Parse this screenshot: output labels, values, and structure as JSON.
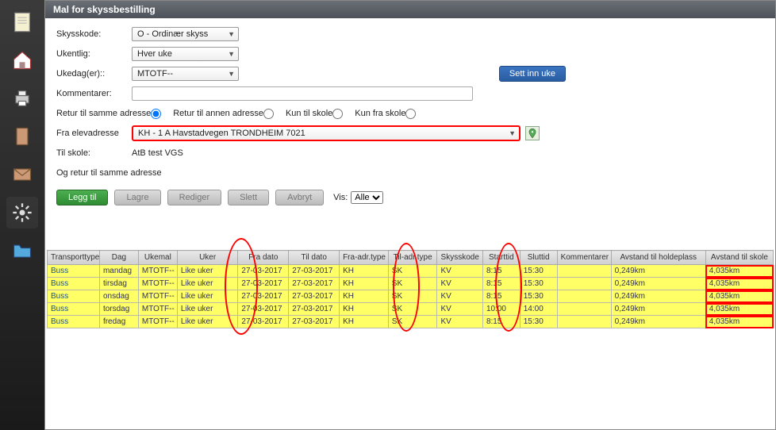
{
  "window": {
    "title": "Mal for skyssbestilling"
  },
  "form": {
    "skysskode_label": "Skysskode:",
    "skysskode_value": "O - Ordinær skyss",
    "ukentlig_label": "Ukentlig:",
    "ukentlig_value": "Hver uke",
    "ukedager_label": "Ukedag(er)::",
    "ukedager_value": "MTOTF--",
    "sett_inn_uke_label": "Sett inn uke",
    "kommentarer_label": "Kommentarer:",
    "kommentarer_value": "",
    "radio_retur_samme_label": "Retur til samme adresse",
    "radio_retur_annen_label": "Retur til annen adresse",
    "radio_kun_til_skole_label": "Kun til skole",
    "radio_kun_fra_skole_label": "Kun fra skole",
    "fra_elevadresse_label": "Fra elevadresse",
    "fra_elevadresse_value": "KH - 1 A Havstadvegen TRONDHEIM 7021",
    "til_skole_label": "Til skole:",
    "til_skole_value": "AtB test VGS",
    "og_retur_label": "Og retur til samme adresse"
  },
  "buttons": {
    "legg_til": "Legg til",
    "lagre": "Lagre",
    "rediger": "Rediger",
    "slett": "Slett",
    "avbryt": "Avbryt",
    "vis_label": "Vis:",
    "vis_value": "Alle"
  },
  "table": {
    "headers": {
      "transporttype": "Transporttype",
      "dag": "Dag",
      "ukemal": "Ukemal",
      "uker": "Uker",
      "fra_dato": "Fra dato",
      "til_dato": "Til dato",
      "fra_adr_type": "Fra-adr.type",
      "til_adr_type": "Til-adr.type",
      "skysskode": "Skysskode",
      "starttid": "Starttid",
      "sluttid": "Sluttid",
      "kommentarer": "Kommentarer",
      "avstand_holdeplass": "Avstand til holdeplass",
      "avstand_skole": "Avstand til skole"
    },
    "rows": [
      {
        "transporttype": "Buss",
        "dag": "mandag",
        "ukemal": "MTOTF--",
        "uker": "Like uker",
        "fra_dato": "27-03-2017",
        "til_dato": "27-03-2017",
        "fra_adr": "KH",
        "til_adr": "SK",
        "skysskode": "KV",
        "start": "8:15",
        "slutt": "15:30",
        "komm": "",
        "ahold": "0,249km",
        "askole": "4,035km"
      },
      {
        "transporttype": "Buss",
        "dag": "tirsdag",
        "ukemal": "MTOTF--",
        "uker": "Like uker",
        "fra_dato": "27-03-2017",
        "til_dato": "27-03-2017",
        "fra_adr": "KH",
        "til_adr": "SK",
        "skysskode": "KV",
        "start": "8:15",
        "slutt": "15:30",
        "komm": "",
        "ahold": "0,249km",
        "askole": "4,035km"
      },
      {
        "transporttype": "Buss",
        "dag": "onsdag",
        "ukemal": "MTOTF--",
        "uker": "Like uker",
        "fra_dato": "27-03-2017",
        "til_dato": "27-03-2017",
        "fra_adr": "KH",
        "til_adr": "SK",
        "skysskode": "KV",
        "start": "8:15",
        "slutt": "15:30",
        "komm": "",
        "ahold": "0,249km",
        "askole": "4,035km"
      },
      {
        "transporttype": "Buss",
        "dag": "torsdag",
        "ukemal": "MTOTF--",
        "uker": "Like uker",
        "fra_dato": "27-03-2017",
        "til_dato": "27-03-2017",
        "fra_adr": "KH",
        "til_adr": "SK",
        "skysskode": "KV",
        "start": "10:00",
        "slutt": "14:00",
        "komm": "",
        "ahold": "0,249km",
        "askole": "4,035km"
      },
      {
        "transporttype": "Buss",
        "dag": "fredag",
        "ukemal": "MTOTF--",
        "uker": "Like uker",
        "fra_dato": "27-03-2017",
        "til_dato": "27-03-2017",
        "fra_adr": "KH",
        "til_adr": "SK",
        "skysskode": "KV",
        "start": "8:15",
        "slutt": "15:30",
        "komm": "",
        "ahold": "0,249km",
        "askole": "4,035km"
      }
    ]
  },
  "icons": {
    "sidebar": [
      "notepad-icon",
      "home-icon",
      "printer-icon",
      "book-icon",
      "mail-icon",
      "gear-icon",
      "folder-icon"
    ]
  }
}
